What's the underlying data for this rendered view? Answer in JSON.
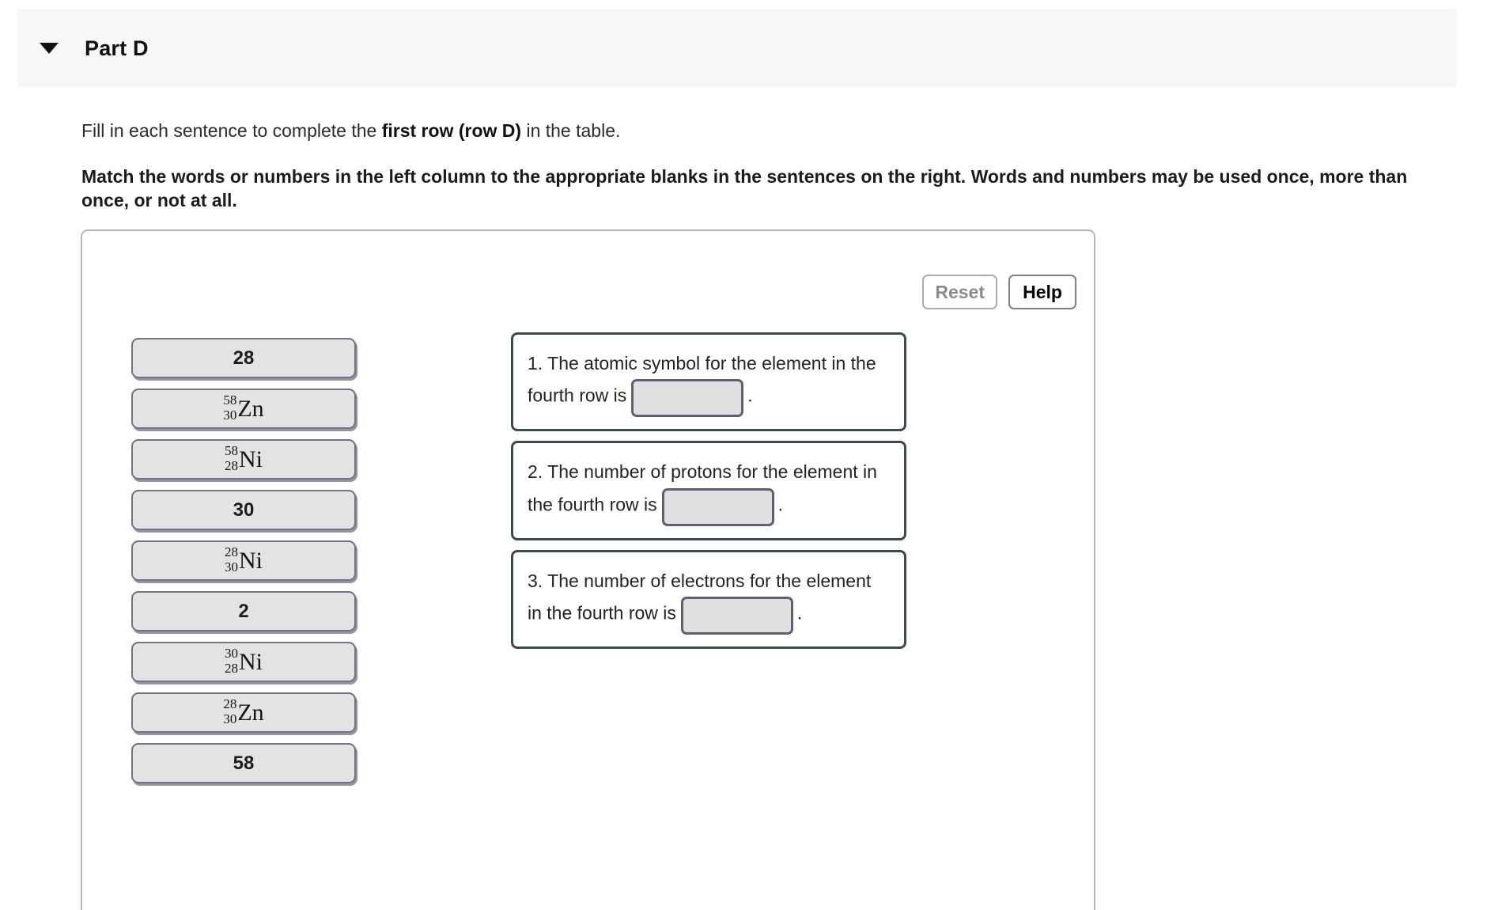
{
  "header": {
    "title": "Part D",
    "disclosure_icon": "triangle-down-icon"
  },
  "instructions": {
    "line1_pre": "Fill in each sentence to complete the ",
    "line1_bold": "first row (row D)",
    "line1_post": " in the table.",
    "line2": "Match the words or numbers in the left column to the appropriate blanks in the sentences on the right. Words and numbers may be used once, more than once, or not at all."
  },
  "toolbar": {
    "reset_label": "Reset",
    "help_label": "Help",
    "reset_state": "disabled",
    "help_state": "enabled"
  },
  "tiles": [
    {
      "type": "plain",
      "text": "28"
    },
    {
      "type": "isotope",
      "mass": "58",
      "atomic": "30",
      "symbol": "Zn",
      "text": "58/30 Zn"
    },
    {
      "type": "isotope",
      "mass": "58",
      "atomic": "28",
      "symbol": "Ni",
      "text": "58/28 Ni"
    },
    {
      "type": "plain",
      "text": "30"
    },
    {
      "type": "isotope",
      "mass": "28",
      "atomic": "30",
      "symbol": "Ni",
      "text": "28/30 Ni"
    },
    {
      "type": "plain",
      "text": "2"
    },
    {
      "type": "isotope",
      "mass": "30",
      "atomic": "28",
      "symbol": "Ni",
      "text": "30/28 Ni"
    },
    {
      "type": "isotope",
      "mass": "28",
      "atomic": "30",
      "symbol": "Zn",
      "text": "28/30 Zn"
    },
    {
      "type": "plain",
      "text": "58"
    }
  ],
  "sentences": [
    {
      "number": "1.",
      "text_before": "The atomic symbol for the element in the fourth row is",
      "blank_value": "",
      "text_after": "."
    },
    {
      "number": "2.",
      "text_before": "The number of protons for the element in the fourth row is",
      "blank_value": "",
      "text_after": "."
    },
    {
      "number": "3.",
      "text_before": "The number of electrons for the element in the fourth row is",
      "blank_value": "",
      "text_after": "."
    }
  ],
  "colors": {
    "header_bg": "#f7f7f7",
    "tile_fill": "#e3e3e3",
    "tile_border": "#6f7383",
    "sentence_border": "#3c4a4e",
    "blank_fill": "#e0e0e0",
    "blank_border": "#5c6070",
    "panel_border": "#b6b6b6"
  }
}
